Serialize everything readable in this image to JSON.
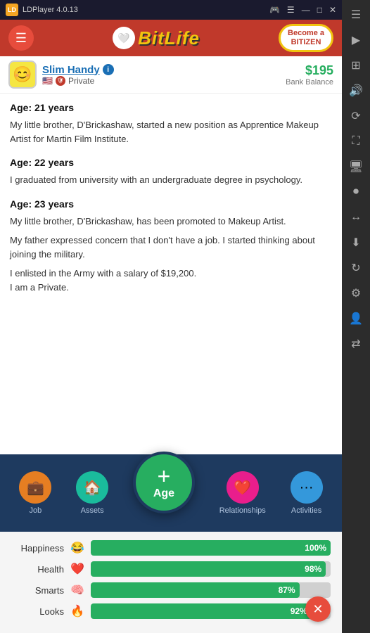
{
  "titlebar": {
    "app_name": "LDPlayer 4.0.13",
    "controls": [
      "⊟",
      "—",
      "□",
      "✕"
    ]
  },
  "header": {
    "menu_label": "☰",
    "logo_text": "BitLife",
    "logo_icon": "♥",
    "bitizen_line1": "Become a",
    "bitizen_line2": "BITIZEN"
  },
  "profile": {
    "name": "Slim Handy",
    "rank": "Private",
    "balance": "$195",
    "balance_label": "Bank Balance",
    "flag": "🇺🇸",
    "avatar": "😊"
  },
  "story": [
    {
      "age": "Age: 21 years",
      "text": "My little brother, D'Brickashaw, started a new position as Apprentice Makeup Artist for Martin Film Institute."
    },
    {
      "age": "Age: 22 years",
      "text": "I graduated from university with an undergraduate degree in psychology."
    },
    {
      "age": "Age: 23 years",
      "text1": "My little brother, D'Brickashaw, has been promoted to Makeup Artist.",
      "text2": "My father expressed concern that I don't have a job. I started thinking about joining the military.",
      "text3": "I enlisted in the Army with a salary of $19,200.",
      "text4": "I am a Private."
    }
  ],
  "nav": {
    "job_label": "Job",
    "assets_label": "Assets",
    "age_label": "Age",
    "age_plus": "+",
    "relationships_label": "Relationships",
    "activities_label": "Activities"
  },
  "stats": [
    {
      "label": "Happiness",
      "emoji": "😂",
      "value": 100,
      "display": "100%"
    },
    {
      "label": "Health",
      "emoji": "❤️",
      "value": 98,
      "display": "98%"
    },
    {
      "label": "Smarts",
      "emoji": "🧠",
      "value": 87,
      "display": "87%"
    },
    {
      "label": "Looks",
      "emoji": "🔥",
      "value": 92,
      "display": "92%"
    }
  ],
  "sidebar_icons": [
    "☰",
    "▶",
    "⊞",
    "♫",
    "⟲",
    "▷",
    "⊡",
    "📋",
    "↔",
    "⬇",
    "↻",
    "⊙"
  ],
  "close_btn": "✕"
}
